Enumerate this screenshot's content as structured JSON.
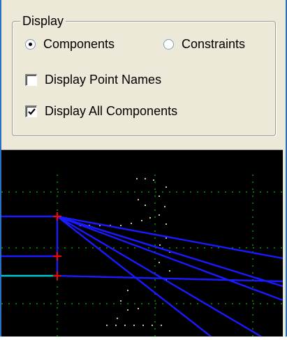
{
  "display_group": {
    "title": "Display",
    "mode_options": [
      {
        "label": "Components",
        "selected": true
      },
      {
        "label": "Constraints",
        "selected": false
      }
    ],
    "checkboxes": [
      {
        "label": "Display Point Names",
        "checked": false
      },
      {
        "label": "Display All Components",
        "checked": true
      }
    ]
  },
  "colors": {
    "panel_bg": "#ece9d8",
    "canvas_bg": "#000000",
    "grid": "#00c000",
    "scatter_dots": "#c8c8a0",
    "component_lines": "#1a1aff",
    "highlight_line": "#00c8d0",
    "point_markers": "#ff0000"
  }
}
